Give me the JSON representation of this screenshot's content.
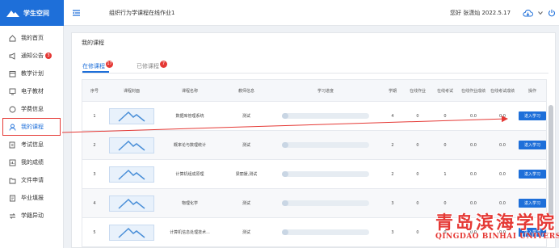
{
  "header": {
    "brand": "学生空间",
    "page_heading": "组织行为学课程在线作业1",
    "greeting": "您好 张潇灿 2022.5.17",
    "icons": [
      "logo-icon",
      "collapse-menu-icon",
      "cloud-download-icon",
      "chevron-down-icon",
      "power-icon"
    ]
  },
  "sidebar": {
    "items": [
      {
        "label": "我的首页",
        "icon": "home-icon"
      },
      {
        "label": "通知公告",
        "icon": "megaphone-icon",
        "badge": "3"
      },
      {
        "label": "教学计划",
        "icon": "calendar-icon"
      },
      {
        "label": "电子教材",
        "icon": "monitor-icon"
      },
      {
        "label": "学费信息",
        "icon": "coin-icon"
      },
      {
        "label": "我的课程",
        "icon": "user-icon",
        "active": true
      },
      {
        "label": "考试信息",
        "icon": "edit-icon"
      },
      {
        "label": "我的成绩",
        "icon": "chart-icon"
      },
      {
        "label": "文件申请",
        "icon": "folder-icon"
      },
      {
        "label": "毕业填报",
        "icon": "form-icon"
      },
      {
        "label": "学籍异动",
        "icon": "transfer-icon"
      }
    ]
  },
  "main": {
    "section_title": "我的课程",
    "tabs": [
      {
        "label": "在修课程",
        "badge": "17",
        "active": true
      },
      {
        "label": "已修课程",
        "badge": "7",
        "active": false
      }
    ],
    "table": {
      "columns": [
        "序号",
        "课程封面",
        "课程名称",
        "教师信息",
        "学习进度",
        "学期",
        "在线作业",
        "在线考试",
        "在线作业成绩",
        "在线考试成绩",
        "操作"
      ],
      "rows": [
        {
          "index": "1",
          "name": "数据库管理系统",
          "teacher": "测试",
          "progress": 0.02,
          "term": "4",
          "hw": "0",
          "exam": "0",
          "hw_score": "0.0",
          "exam_score": "0.0",
          "action": "进入学习"
        },
        {
          "index": "2",
          "name": "概率论与数理统计",
          "teacher": "测试",
          "progress": 0.02,
          "term": "2",
          "hw": "0",
          "exam": "0",
          "hw_score": "0.0",
          "exam_score": "0.0",
          "action": "进入学习"
        },
        {
          "index": "3",
          "name": "计算机组成原理",
          "teacher": "梁丽媛,测试",
          "progress": 0.02,
          "term": "2",
          "hw": "0",
          "exam": "1",
          "hw_score": "0.0",
          "exam_score": "0.0",
          "action": "进入学习"
        },
        {
          "index": "4",
          "name": "物理化学",
          "teacher": "测试",
          "progress": 0.02,
          "term": "3",
          "hw": "0",
          "exam": "0",
          "hw_score": "0.0",
          "exam_score": "0.0",
          "action": "进入学习"
        },
        {
          "index": "5",
          "name": "计算机信息处理技术...",
          "teacher": "测试",
          "progress": 0.02,
          "term": "3",
          "hw": "0",
          "exam": "0",
          "hw_score": "0.0",
          "exam_score": "0.0",
          "action": "进入学习"
        }
      ]
    }
  },
  "watermark": {
    "cn": "青岛滨海学院",
    "en": "QINGDAO BINHAI UNIVERSITY"
  },
  "colors": {
    "accent": "#1e6fd9",
    "annotation": "#e53935"
  }
}
